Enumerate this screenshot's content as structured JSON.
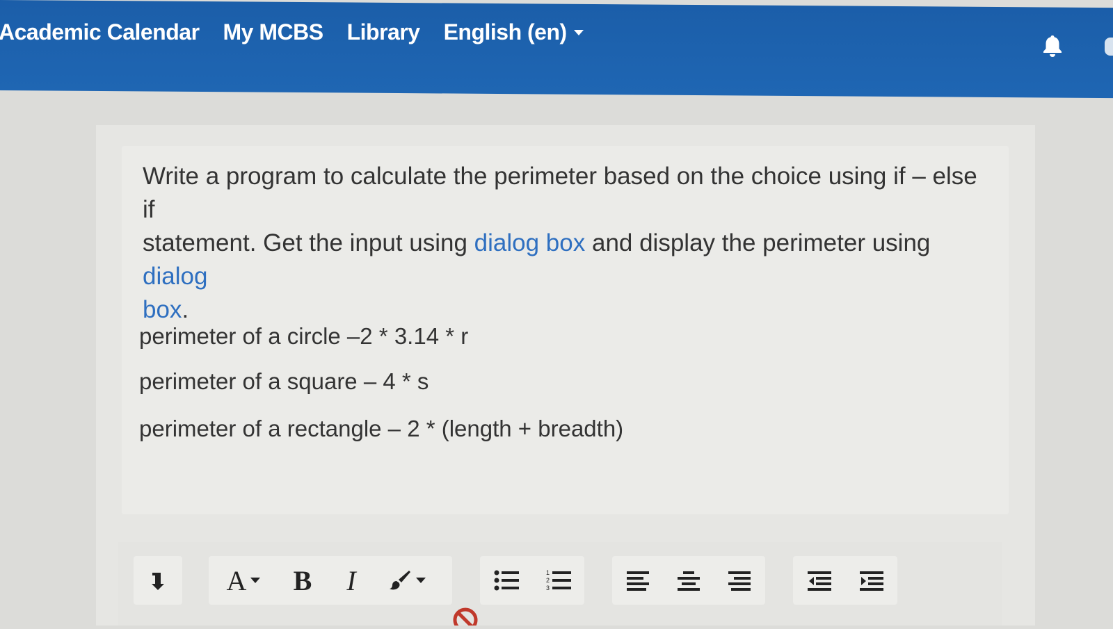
{
  "navbar": {
    "links": [
      "Academic Calendar",
      "My MCBS",
      "Library"
    ],
    "language": "English (en)",
    "notification_icon": "bell-icon",
    "color": "#1f66b3"
  },
  "question": {
    "line1": "Write a program to calculate the perimeter based on the choice using  if – else if",
    "line2_pre": "statement.  Get the input using ",
    "link1": "dialog box",
    "line2_mid": "  and display the perimeter using ",
    "link2a": "dialog",
    "link2b": "box",
    "end": ".",
    "link_color": "#2e6fc0"
  },
  "formulas": [
    "perimeter  of a circle –2 * 3.14 * r",
    "perimeter of a square  – 4 * s",
    "perimeter  of a rectangle – 2 * (length + breadth)"
  ],
  "toolbar": {
    "font_button": "A",
    "bold_button": "B",
    "italic_button": "I",
    "icons": [
      "collapse-icon",
      "font-color-icon",
      "bold-icon",
      "italic-icon",
      "paint-brush-icon",
      "bullet-list-icon",
      "numbered-list-icon",
      "align-left-icon",
      "align-center-icon",
      "align-right-icon",
      "outdent-icon",
      "indent-icon",
      "no-entry-icon"
    ]
  }
}
